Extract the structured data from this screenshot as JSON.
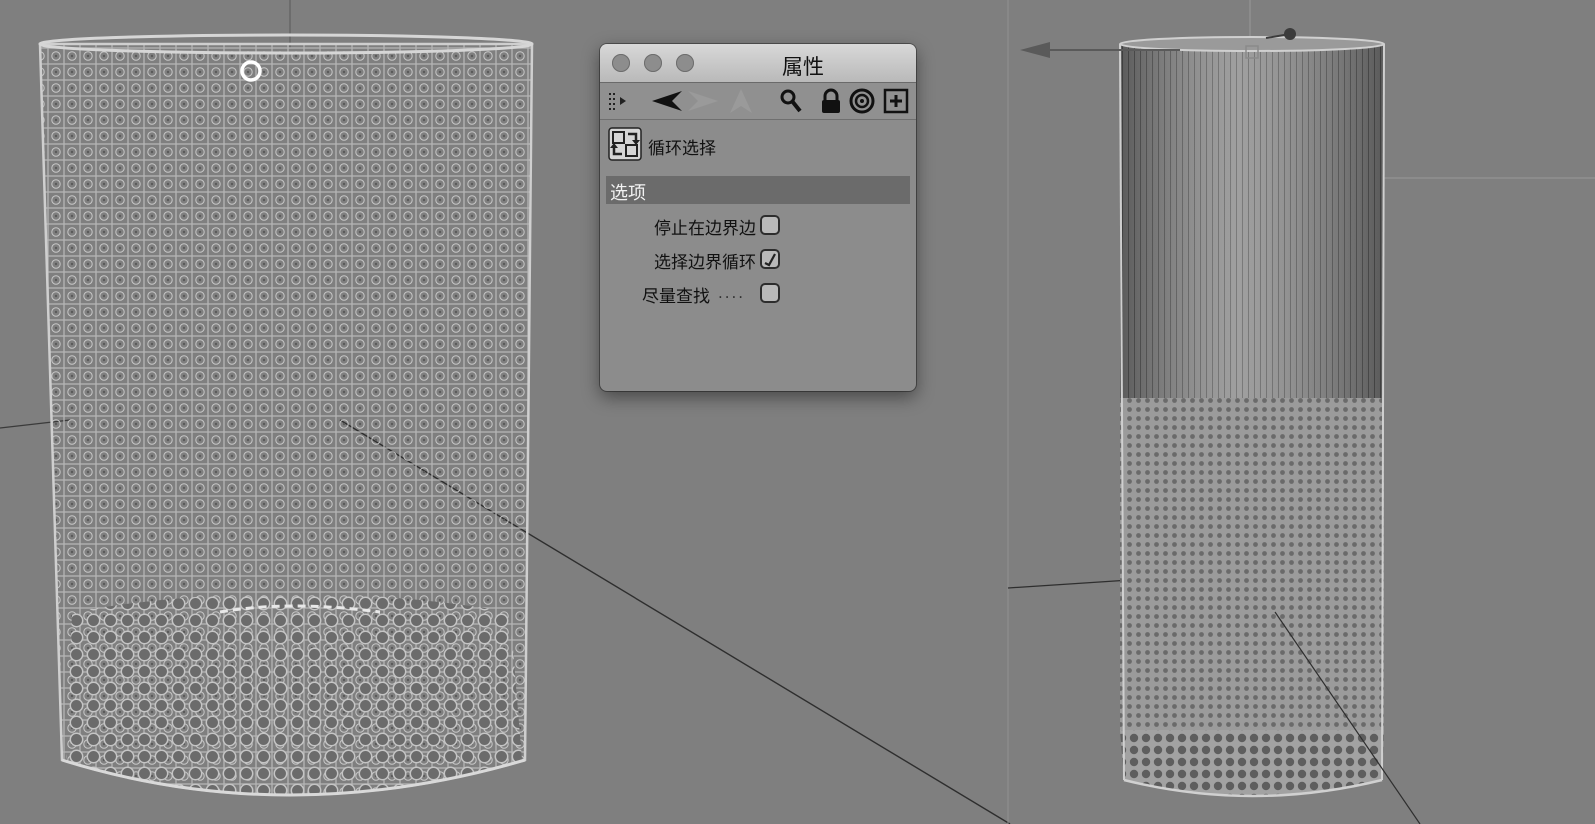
{
  "panel": {
    "title": "属性",
    "mode_title": "循环选择",
    "section_title": "选项",
    "options": [
      {
        "label": "停止在边界边",
        "checked": false
      },
      {
        "label": "选择边界循环",
        "checked": true
      },
      {
        "label": "尽量查找",
        "checked": false
      }
    ],
    "toolbar_icons": [
      "drag-handle-icon",
      "back-arrow-icon",
      "forward-arrow-icon",
      "up-arrow-icon",
      "search-icon",
      "lock-icon",
      "target-icon",
      "add-panel-icon"
    ]
  },
  "colors": {
    "viewport_bg": "#7f7f7f",
    "panel_bg": "#8c8c8c",
    "section_header_bg": "#6b6b6b",
    "mesh_line": "#b8b8b8"
  }
}
